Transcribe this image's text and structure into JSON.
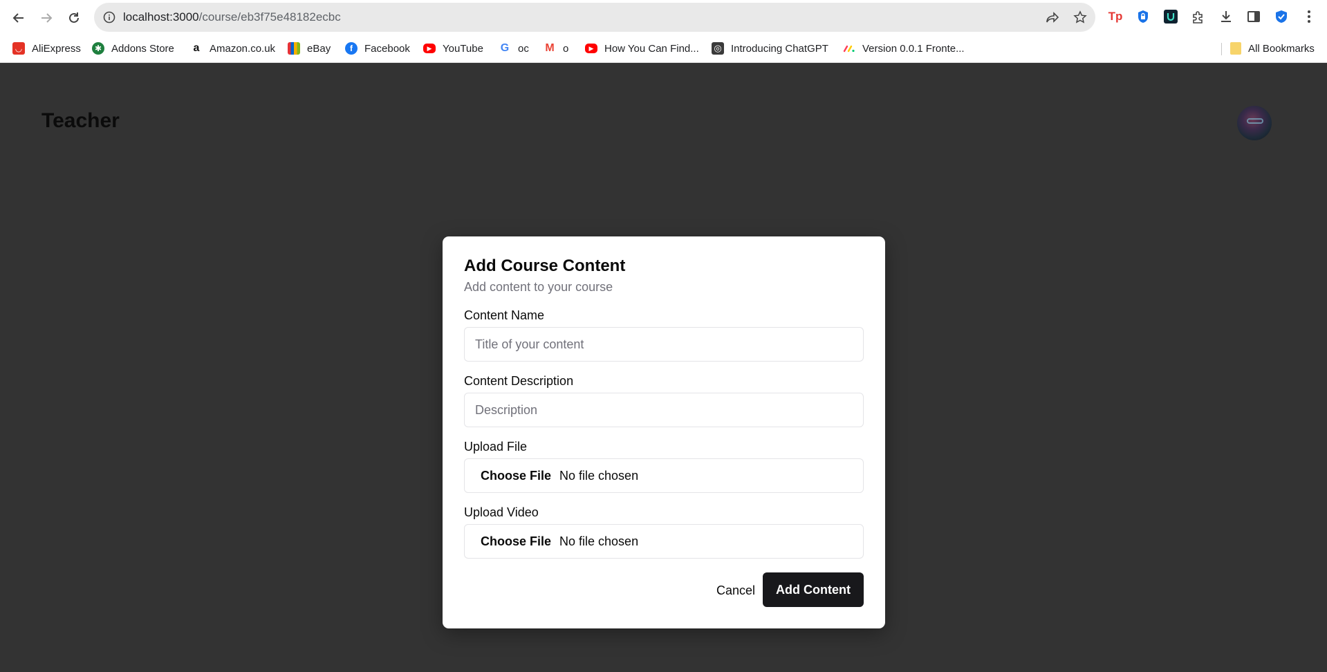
{
  "browser": {
    "url_host": "localhost:3000",
    "url_path": "/course/eb3f75e48182ecbc",
    "icons": {
      "back": "back-arrow-icon",
      "forward": "forward-arrow-icon",
      "reload": "reload-icon",
      "info": "info-icon",
      "share": "share-icon",
      "star": "bookmark-star-icon",
      "menu": "kebab-menu-icon"
    },
    "extensions": [
      "tp-extension-icon",
      "shield-lock-extension-icon",
      "u-extension-icon",
      "puzzle-extensions-icon",
      "download-icon",
      "side-panel-icon",
      "blue-shield-extension-icon"
    ]
  },
  "bookmarks": [
    {
      "label": "AliExpress",
      "color": "#e43225",
      "glyph": "◡"
    },
    {
      "label": "Addons Store",
      "color": "#1e7f3e",
      "glyph": "✱"
    },
    {
      "label": "Amazon.co.uk",
      "color": "#ffffff",
      "glyph": "a"
    },
    {
      "label": "eBay",
      "color": "#3a3a3a",
      "glyph": "▦"
    },
    {
      "label": "Facebook",
      "color": "#1877f2",
      "glyph": "f"
    },
    {
      "label": "YouTube",
      "color": "#ff0000",
      "glyph": "▶"
    },
    {
      "label": "oc",
      "color": "#ffffff",
      "glyph": "G"
    },
    {
      "label": "o",
      "color": "#ffffff",
      "glyph": "M"
    },
    {
      "label": "How You Can Find...",
      "color": "#ff0000",
      "glyph": "▶"
    },
    {
      "label": "Introducing ChatGPT",
      "color": "#3a3a3a",
      "glyph": "◎"
    },
    {
      "label": "Version 0.0.1 Fronte...",
      "color": "#ffffff",
      "glyph": "⋰"
    }
  ],
  "all_bookmarks": "All Bookmarks",
  "page": {
    "title": "Teacher"
  },
  "modal": {
    "title": "Add Course Content",
    "subtitle": "Add content to your course",
    "name_label": "Content Name",
    "name_placeholder": "Title of your content",
    "name_value": "",
    "desc_label": "Content Description",
    "desc_placeholder": "Description",
    "desc_value": "",
    "file_label": "Upload File",
    "file_button": "Choose File",
    "file_status": "No file chosen",
    "video_label": "Upload Video",
    "video_button": "Choose File",
    "video_status": "No file chosen",
    "cancel": "Cancel",
    "submit": "Add Content"
  },
  "colors": {
    "backdrop": "#333333",
    "primary_button": "#18181b",
    "muted_text": "#71717a"
  }
}
